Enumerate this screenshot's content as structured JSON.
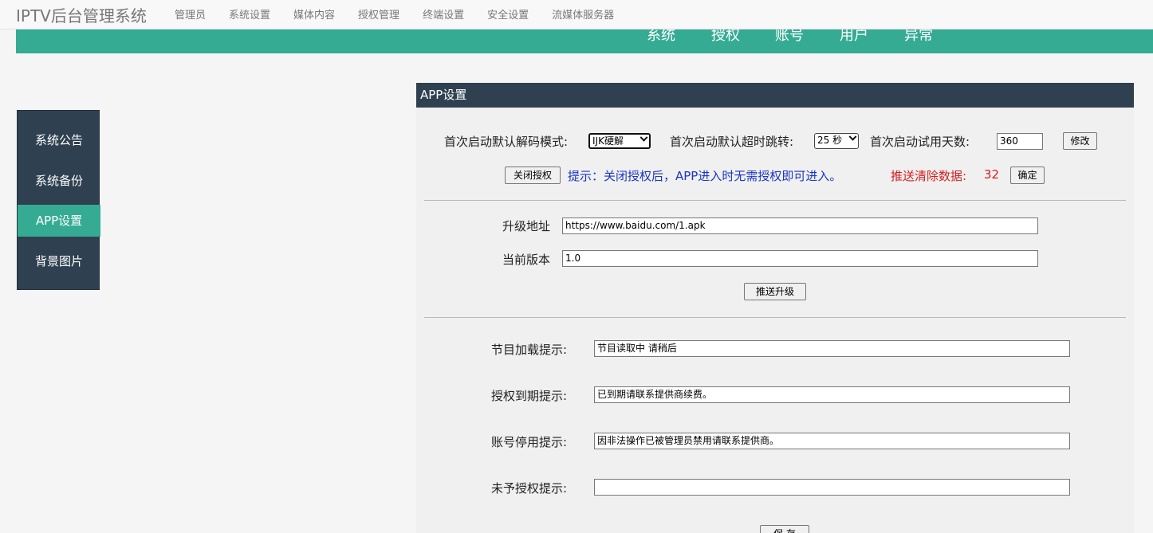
{
  "app": {
    "title": "IPTV后台管理系统"
  },
  "topnav": [
    "管理员",
    "系统设置",
    "媒体内容",
    "授权管理",
    "终端设置",
    "安全设置",
    "流媒体服务器"
  ],
  "subnav": [
    "系统",
    "授权",
    "账号",
    "用户",
    "异常"
  ],
  "sidebar": {
    "items": [
      {
        "label": "系统公告",
        "active": false
      },
      {
        "label": "系统备份",
        "active": false
      },
      {
        "label": "APP设置",
        "active": true
      },
      {
        "label": "背景图片",
        "active": false
      }
    ]
  },
  "panel": {
    "title": "APP设置",
    "decode_label": "首次启动默认解码模式:",
    "decode_value": "IJK硬解",
    "timeout_label": "首次启动默认超时跳转:",
    "timeout_value": "25 秒",
    "trial_label": "首次启动试用天数:",
    "trial_value": "360",
    "modify_button": "修改",
    "close_auth_button": "关闭授权",
    "hint_text": "提示：关闭授权后，APP进入时无需授权即可进入。",
    "push_clear_label": "推送清除数据:",
    "push_clear_value": "32",
    "confirm_button": "确定",
    "upgrade_url_label": "升级地址",
    "upgrade_url_value": "https://www.baidu.com/1.apk",
    "version_label": "当前版本",
    "version_value": "1.0",
    "push_upgrade_button": "推送升级",
    "loading_label": "节目加载提示:",
    "loading_value": "节目读取中  请稍后",
    "expired_label": "授权到期提示:",
    "expired_value": "已到期请联系提供商续费。",
    "disabled_label": "账号停用提示:",
    "disabled_value": "因非法操作已被管理员禁用请联系提供商。",
    "unauth_label": "未予授权提示:",
    "unauth_value": "",
    "save_button": "保 存"
  },
  "colors": {
    "accent": "#35ab93",
    "dark": "#2f4050",
    "hint": "#1a35c7",
    "alert": "#d21f1f"
  }
}
